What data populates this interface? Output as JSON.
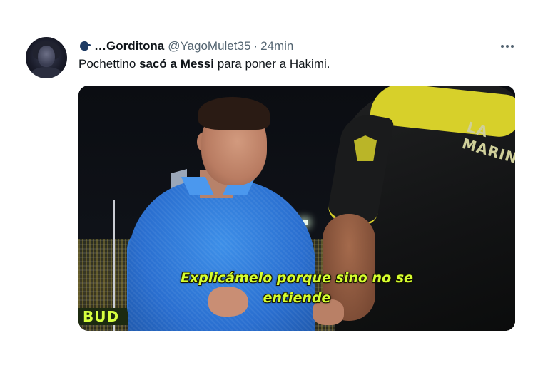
{
  "tweet": {
    "author": {
      "display_name": "…Gorditona",
      "handle": "@YagoMulet35",
      "name_emoji": "speaking-head-icon"
    },
    "separator": "·",
    "time": "24min",
    "text": {
      "part1": "Pochettino ",
      "part2_bold": "sacó a Messi",
      "part3": " para poner a Hakimi."
    },
    "media": {
      "subtitle_line1": "Explicámelo porque sino no se",
      "subtitle_line2": "entiende",
      "jersey_text": "LA MARIN",
      "banner_text": "BUD"
    }
  },
  "colors": {
    "subtitle": "#d6ff2f",
    "text": "#0f1419",
    "muted": "#536471",
    "jersey_accent": "#d7d02a",
    "shirt": "#2a6fd0"
  }
}
